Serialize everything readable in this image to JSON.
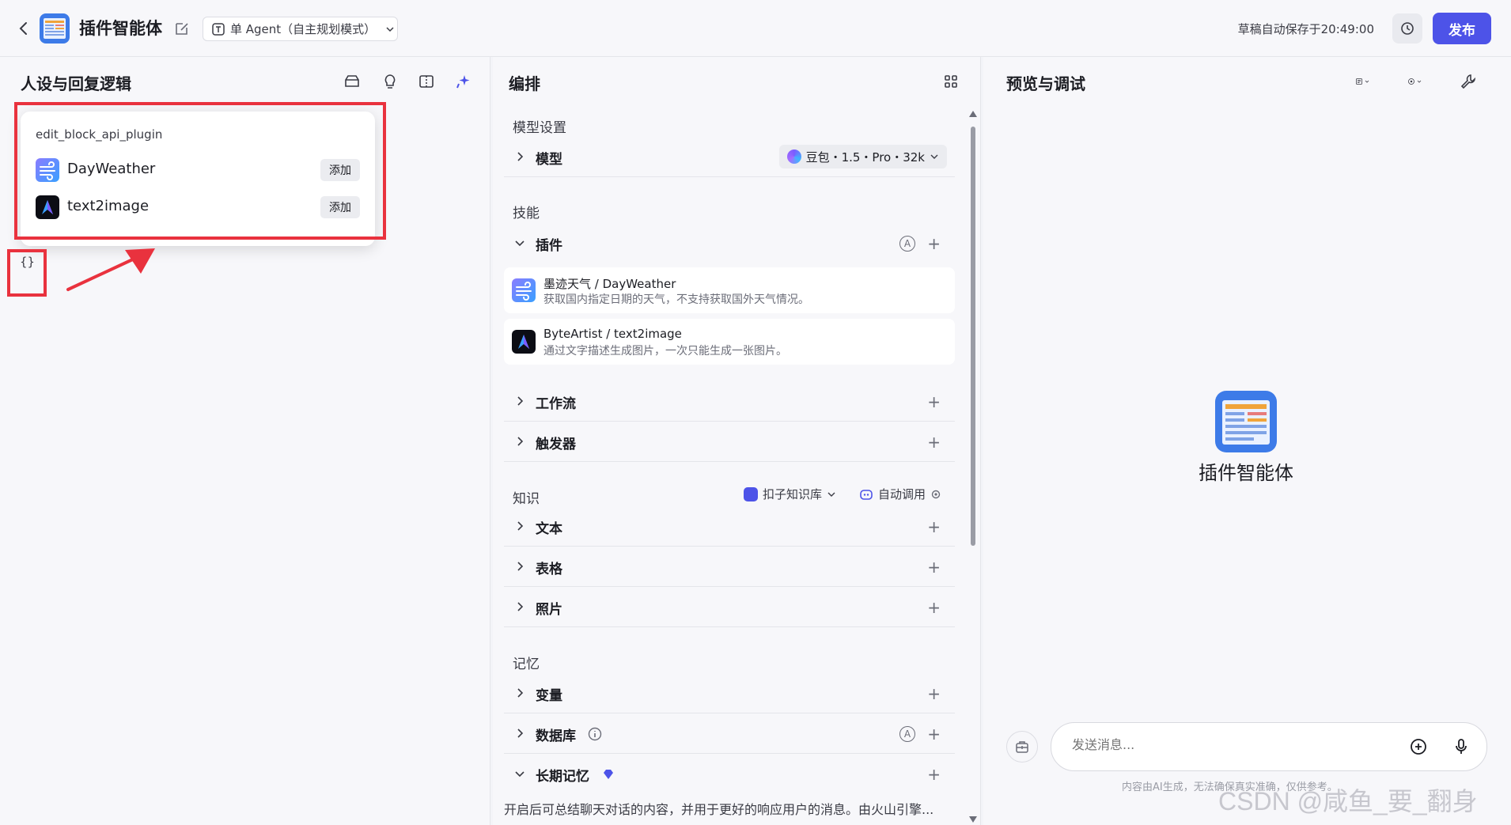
{
  "header": {
    "title": "插件智能体",
    "mode": "单 Agent（自主规划模式）",
    "autosave": "草稿自动保存于20:49:00",
    "publish_label": "发布"
  },
  "left": {
    "title": "人设与回复逻辑",
    "popup": {
      "heading": "edit_block_api_plugin",
      "items": [
        {
          "label": "DayWeather",
          "add": "添加"
        },
        {
          "label": "text2image",
          "add": "添加"
        }
      ]
    },
    "brace": "{}"
  },
  "middle": {
    "title": "编排",
    "model_section": "模型设置",
    "model_row": "模型",
    "model_value": "豆包・1.5・Pro・32k",
    "skills_section": "技能",
    "plugins_row": "插件",
    "auto_badge": "A",
    "plugins": [
      {
        "title": "墨迹天气 / DayWeather",
        "desc": "获取国内指定日期的天气，不支持获取国外天气情况。"
      },
      {
        "title": "ByteArtist / text2image",
        "desc": "通过文字描述生成图片，一次只能生成一张图片。"
      }
    ],
    "workflow_row": "工作流",
    "trigger_row": "触发器",
    "knowledge_section": "知识",
    "kb_select": "扣子知识库",
    "kb_auto": "自动调用",
    "text_row": "文本",
    "table_row": "表格",
    "photo_row": "照片",
    "memory_section": "记忆",
    "variable_row": "变量",
    "database_row": "数据库",
    "longterm_row": "长期记忆",
    "longterm_note": "开启后可总结聊天对话的内容，并用于更好的响应用户的消息。由火山引擎..."
  },
  "right": {
    "title": "预览与调试",
    "agent_name": "插件智能体",
    "input_placeholder": "发送消息...",
    "disclaimer": "内容由AI生成，无法确保真实准确，仅供参考。",
    "watermark": "CSDN @咸鱼_要_翻身"
  }
}
